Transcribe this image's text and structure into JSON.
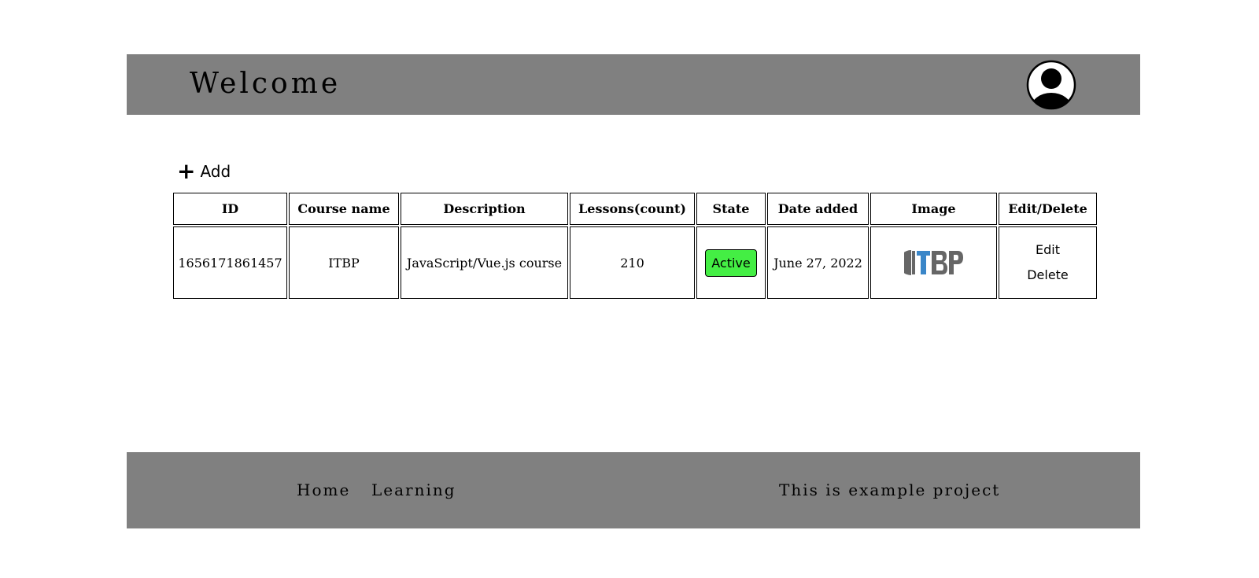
{
  "header": {
    "title": "Welcome",
    "avatar_icon": "user-avatar-icon"
  },
  "toolbar": {
    "add_icon": "plus-icon",
    "add_label": "Add"
  },
  "table": {
    "columns": [
      "ID",
      "Course name",
      "Description",
      "Lessons(count)",
      "State",
      "Date added",
      "Image",
      "Edit/Delete"
    ],
    "rows": [
      {
        "id": "1656171861457",
        "course_name": "ITBP",
        "description": "JavaScript/Vue.js course",
        "lessons": "210",
        "state": "Active",
        "state_color": "#44ee44",
        "date_added": "June 27, 2022",
        "image": "ITBP",
        "edit_label": "Edit",
        "delete_label": "Delete"
      }
    ]
  },
  "footer": {
    "links": [
      "Home",
      "Learning"
    ],
    "text": "This is example project"
  },
  "colors": {
    "bar_background": "#808080",
    "logo_blue": "#3a86c8",
    "logo_grey": "#666666"
  }
}
